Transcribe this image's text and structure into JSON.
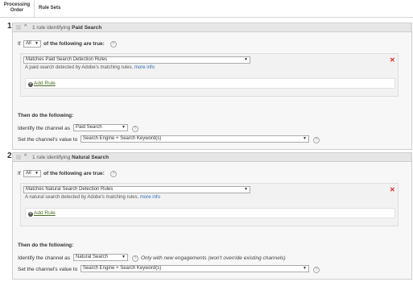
{
  "header": {
    "col1": "Processing Order",
    "col2": "Rule Sets"
  },
  "rulesets": [
    {
      "number": "1",
      "title_prefix": "1 rule identifying",
      "title_name": "Paid Search",
      "if_label": "If",
      "match_value": "All",
      "match_suffix": "of the following are true:",
      "rule_value": "Matches Paid Search Detection Rules",
      "rule_desc": "A paid search detected by Adobe's matching rules.",
      "more_info": "more info",
      "add_rule": "Add Rule",
      "then_label": "Then do the following:",
      "identify_label": "Identify the channel as",
      "channel_value": "Paid Search",
      "note": "",
      "set_label": "Set the channel's value to",
      "set_value": "Search Engine + Search Keyword(s)"
    },
    {
      "number": "2",
      "title_prefix": "1 rule identifying",
      "title_name": "Natural Search",
      "if_label": "If",
      "match_value": "All",
      "match_suffix": "of the following are true:",
      "rule_value": "Matches Natural Search Detection Rules",
      "rule_desc": "A natural search detected by Adobe's matching rules.",
      "more_info": "more info",
      "add_rule": "Add Rule",
      "then_label": "Then do the following:",
      "identify_label": "Identify the channel as",
      "channel_value": "Natural Search",
      "note": "Only with new engagements (won't override existing channels)",
      "set_label": "Set the channel's value to",
      "set_value": "Search Engine + Search Keyword(s)"
    }
  ],
  "icons": {
    "help": "help-icon",
    "remove": "close-icon",
    "add": "plus-circle-icon",
    "collapse": "chevron-up-icon",
    "drag": "drag-handle-icon"
  },
  "colors": {
    "link": "#2d6db5",
    "add_rule": "#4a6d1f",
    "remove": "#dd2222"
  }
}
